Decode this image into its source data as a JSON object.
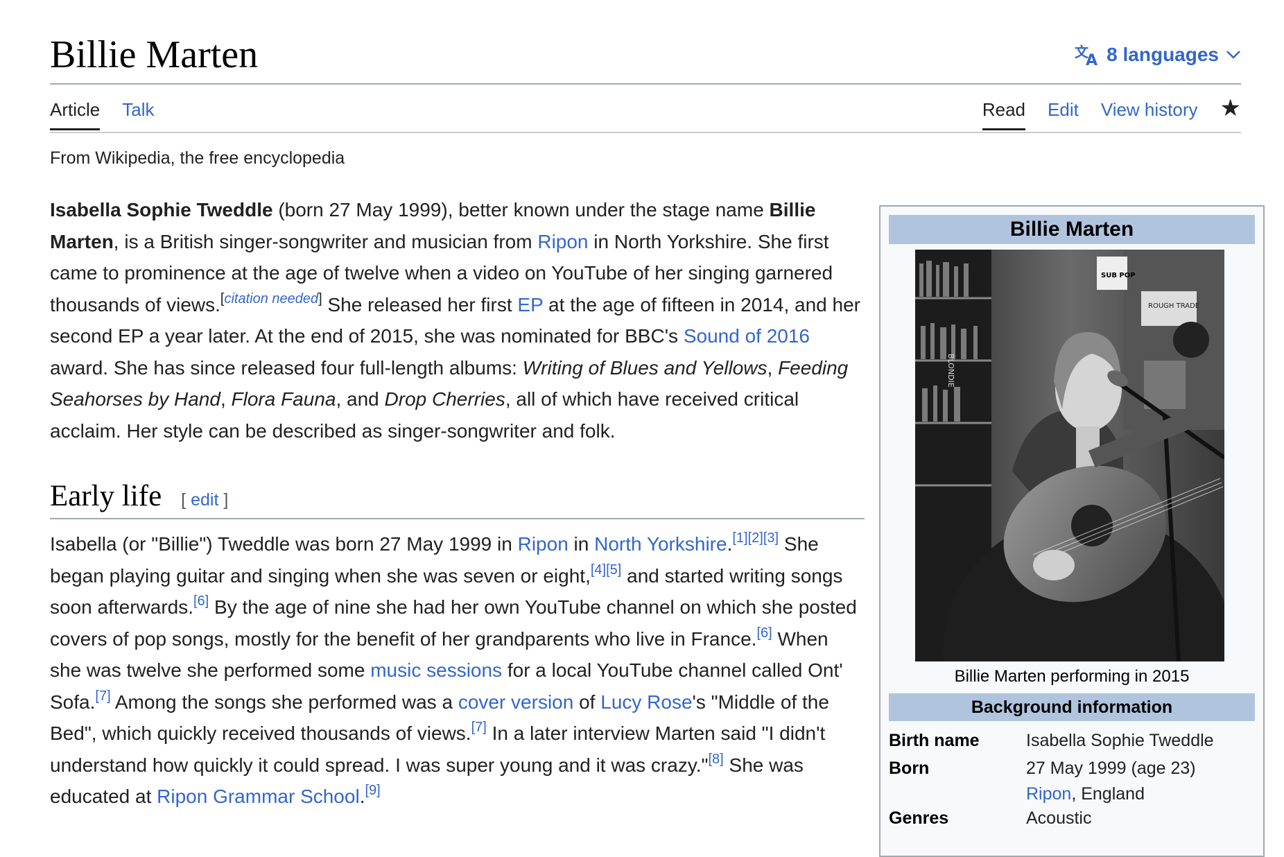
{
  "page": {
    "title": "Billie Marten",
    "languages_label": "8 languages",
    "tagline": "From Wikipedia, the free encyclopedia"
  },
  "tabs": {
    "article": "Article",
    "talk": "Talk",
    "read": "Read",
    "edit": "Edit",
    "history": "View history"
  },
  "intro": {
    "bold_name": "Isabella Sophie Tweddle",
    "t1": " (born 27 May 1999), better known under the stage name ",
    "bold_stage": "Billie Marten",
    "t2": ", is a British singer-songwriter and musician from ",
    "ripon_link": "Ripon",
    "t3": " in North Yorkshire. She first came to prominence at the age of twelve when a video on YouTube of her singing garnered thousands of views.",
    "citation_needed": "citation needed",
    "t4": " She released her first ",
    "ep_link": "EP",
    "t5": " at the age of fifteen in 2014, and her second EP a year later. At the end of 2015, she was nominated for BBC's ",
    "sound_link": "Sound of 2016",
    "t6": " award. She has since released four full-length albums: ",
    "album1": "Writing of Blues and Yellows",
    "album2": "Feeding Seahorses by Hand",
    "album3": "Flora Fauna",
    "album4": "Drop Cherries",
    "t7": ", all of which have received critical acclaim. Her style can be described as singer-songwriter and folk."
  },
  "early_life": {
    "heading": "Early life",
    "edit_label": "edit",
    "s1": "Isabella (or \"Billie\") Tweddle was born 27 May 1999 in ",
    "ripon_link": "Ripon",
    "s2": " in ",
    "ny_link": "North Yorkshire",
    "ref1": "[1]",
    "ref2": "[2]",
    "ref3": "[3]",
    "s3": " She began playing guitar and singing when she was seven or eight,",
    "ref4": "[4]",
    "ref5": "[5]",
    "s4": " and started writing songs soon afterwards.",
    "ref6": "[6]",
    "s5": " By the age of nine she had her own YouTube channel on which she posted covers of pop songs, mostly for the benefit of her grandparents who live in France.",
    "ref6b": "[6]",
    "s6": " When she was twelve she performed some ",
    "music_link": "music sessions",
    "s7": " for a local YouTube channel called Ont' Sofa.",
    "ref7": "[7]",
    "s8": " Among the songs she performed was a ",
    "cover_link": "cover version",
    "s9": " of ",
    "lucy_link": "Lucy Rose",
    "s10": "'s \"Middle of the Bed\", which quickly received thousands of views.",
    "ref7b": "[7]",
    "s11": " In a later interview Marten said \"I didn't understand how quickly it could spread. I was super young and it was crazy.\"",
    "ref8": "[8]",
    "s12": " She was educated at ",
    "school_link": "Ripon Grammar School",
    "ref9": "[9]"
  },
  "infobox": {
    "title": "Billie Marten",
    "caption": "Billie Marten performing in 2015",
    "section": "Background information",
    "birth_name_label": "Birth name",
    "birth_name_value": "Isabella Sophie Tweddle",
    "born_label": "Born",
    "born_value": "27 May 1999 (age 23)",
    "born_place_link": "Ripon",
    "born_place_rest": ", England",
    "genres_label": "Genres",
    "genres_value": "Acoustic",
    "photo_signs": [
      "ROUGH TRADE",
      "SUB POP",
      "BLONDIE"
    ]
  },
  "colors": {
    "link": "#3366cc",
    "infobox_header": "#b0c4de",
    "text": "#202122"
  }
}
